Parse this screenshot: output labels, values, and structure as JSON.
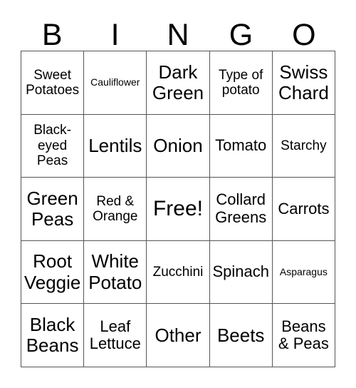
{
  "card": {
    "title": "BINGO",
    "header_letters": [
      "B",
      "I",
      "N",
      "G",
      "O"
    ],
    "columns": 5,
    "rows": 5,
    "free_space": {
      "row": 2,
      "col": 2,
      "label": "Free!"
    },
    "colors": {
      "text": "#000000",
      "background": "#ffffff",
      "grid_line": "#555555"
    },
    "cells": [
      [
        {
          "label": "Sweet\nPotatoes",
          "size": "sm"
        },
        {
          "label": "Cauliflower",
          "size": "xs"
        },
        {
          "label": "Dark\nGreen",
          "size": "lg"
        },
        {
          "label": "Type of\npotato",
          "size": "sm"
        },
        {
          "label": "Swiss\nChard",
          "size": "lg"
        }
      ],
      [
        {
          "label": "Black-\neyed\nPeas",
          "size": "sm"
        },
        {
          "label": "Lentils",
          "size": "lg"
        },
        {
          "label": "Onion",
          "size": "lg"
        },
        {
          "label": "Tomato",
          "size": "md"
        },
        {
          "label": "Starchy",
          "size": "sm"
        }
      ],
      [
        {
          "label": "Green\nPeas",
          "size": "lg"
        },
        {
          "label": "Red &\nOrange",
          "size": "sm"
        },
        {
          "label": "Free!",
          "size": "xl"
        },
        {
          "label": "Collard\nGreens",
          "size": "md"
        },
        {
          "label": "Carrots",
          "size": "md"
        }
      ],
      [
        {
          "label": "Root\nVeggie",
          "size": "lg"
        },
        {
          "label": "White\nPotato",
          "size": "lg"
        },
        {
          "label": "Zucchini",
          "size": "sm"
        },
        {
          "label": "Spinach",
          "size": "md"
        },
        {
          "label": "Asparagus",
          "size": "xs"
        }
      ],
      [
        {
          "label": "Black\nBeans",
          "size": "lg"
        },
        {
          "label": "Leaf\nLettuce",
          "size": "md"
        },
        {
          "label": "Other",
          "size": "lg"
        },
        {
          "label": "Beets",
          "size": "lg"
        },
        {
          "label": "Beans\n& Peas",
          "size": "md"
        }
      ]
    ]
  }
}
